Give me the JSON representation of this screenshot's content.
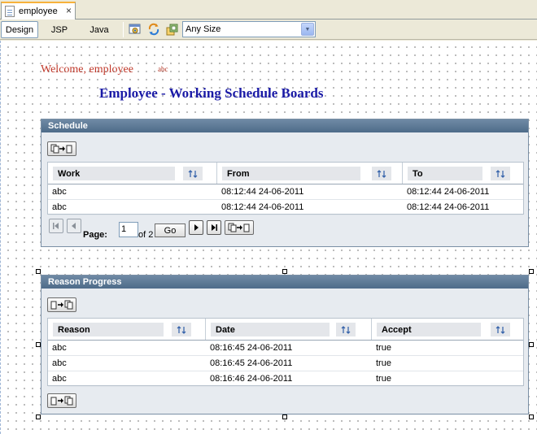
{
  "editor_tab": {
    "label": "employee",
    "close": "×"
  },
  "toolbar": {
    "views": [
      "Design",
      "JSP",
      "Java"
    ],
    "size_value": "Any Size"
  },
  "page": {
    "welcome": "Welcome, employee",
    "user_id": "abc",
    "title": "Employee - Working Schedule Boards"
  },
  "schedule": {
    "title": "Schedule",
    "columns": [
      "Work",
      "From",
      "To"
    ],
    "rows": [
      [
        "abc",
        "08:12:44 24-06-2011",
        "08:12:44 24-06-2011"
      ],
      [
        "abc",
        "08:12:44 24-06-2011",
        "08:12:44 24-06-2011"
      ]
    ],
    "pager": {
      "page_label": "Page:",
      "page_value": "1",
      "of_label": "of 2",
      "go": "Go"
    }
  },
  "reason": {
    "title": "Reason Progress",
    "columns": [
      "Reason",
      "Date",
      "Accept"
    ],
    "rows": [
      [
        "abc",
        "08:16:45 24-06-2011",
        "true"
      ],
      [
        "abc",
        "08:16:45 24-06-2011",
        "true"
      ],
      [
        "abc",
        "08:16:46 24-06-2011",
        "true"
      ]
    ]
  },
  "icons": {
    "tab": "jsp-file-icon",
    "toolbar": [
      "preview-icon",
      "refresh-icon",
      "components-icon"
    ],
    "export": "export-icon",
    "import": "import-icon",
    "sort": "sort-icon"
  }
}
